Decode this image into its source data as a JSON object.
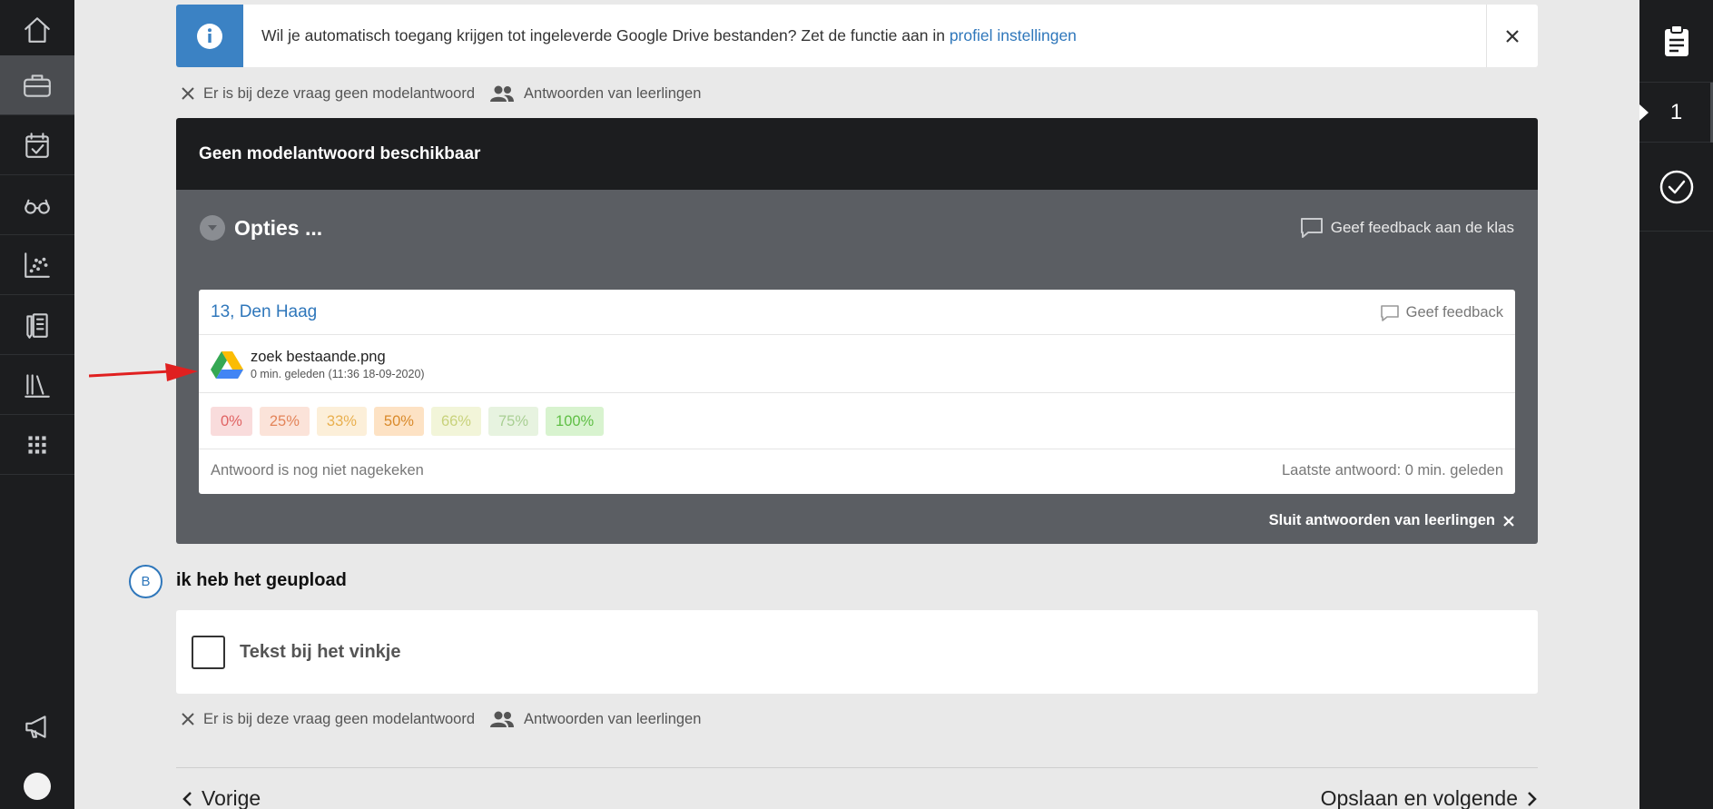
{
  "sidebar": {
    "items": [
      {
        "icon": "home-icon"
      },
      {
        "icon": "briefcase-icon",
        "active": true
      },
      {
        "icon": "calendar-check-icon"
      },
      {
        "icon": "glasses-icon"
      },
      {
        "icon": "scatter-chart-icon"
      },
      {
        "icon": "book-pencil-icon"
      },
      {
        "icon": "library-icon"
      },
      {
        "icon": "apps-grid-icon"
      },
      {
        "icon": "megaphone-icon"
      },
      {
        "icon": "avatar-icon"
      }
    ]
  },
  "right_panel": {
    "clipboard_icon": "clipboard-icon",
    "question_number": "1",
    "check_icon": "check-circle-icon"
  },
  "banner": {
    "text": "Wil je automatisch toegang krijgen tot ingeleverde Google Drive bestanden? Zet de functie aan in ",
    "link": "profiel instellingen"
  },
  "question_a": {
    "no_model_answer": "Er is bij deze vraag geen modelantwoord",
    "student_answers": "Antwoorden van leerlingen"
  },
  "answers_panel": {
    "header": "Geen modelantwoord beschikbaar",
    "options": "Opties ...",
    "feedback_class": "Geef feedback aan de klas",
    "student": "13, Den Haag",
    "feedback": "Geef feedback",
    "file_name": "zoek bestaande.png",
    "file_time": "0 min. geleden (11:36 18-09-2020)",
    "grades": [
      {
        "label": "0%",
        "bg": "#f9dcdc",
        "color": "#e06363"
      },
      {
        "label": "25%",
        "bg": "#fbe3d9",
        "color": "#e38459"
      },
      {
        "label": "33%",
        "bg": "#fcefd9",
        "color": "#e9b04f"
      },
      {
        "label": "50%",
        "bg": "#fde2c4",
        "color": "#d98a2b"
      },
      {
        "label": "66%",
        "bg": "#f2f5d9",
        "color": "#c8d27b"
      },
      {
        "label": "75%",
        "bg": "#e7f3e0",
        "color": "#a9cf93"
      },
      {
        "label": "100%",
        "bg": "#d8f3cf",
        "color": "#5fbf45"
      }
    ],
    "status": "Antwoord is nog niet nagekeken",
    "last_answer": "Laatste antwoord: 0 min. geleden",
    "close": "Sluit antwoorden van leerlingen"
  },
  "question_b": {
    "letter": "B",
    "title": "ik heb het geupload",
    "checkbox_label": "Tekst bij het vinkje",
    "no_model_answer": "Er is bij deze vraag geen modelantwoord",
    "student_answers": "Antwoorden van leerlingen"
  },
  "footer": {
    "prev": "Vorige",
    "next": "Opslaan en volgende"
  }
}
